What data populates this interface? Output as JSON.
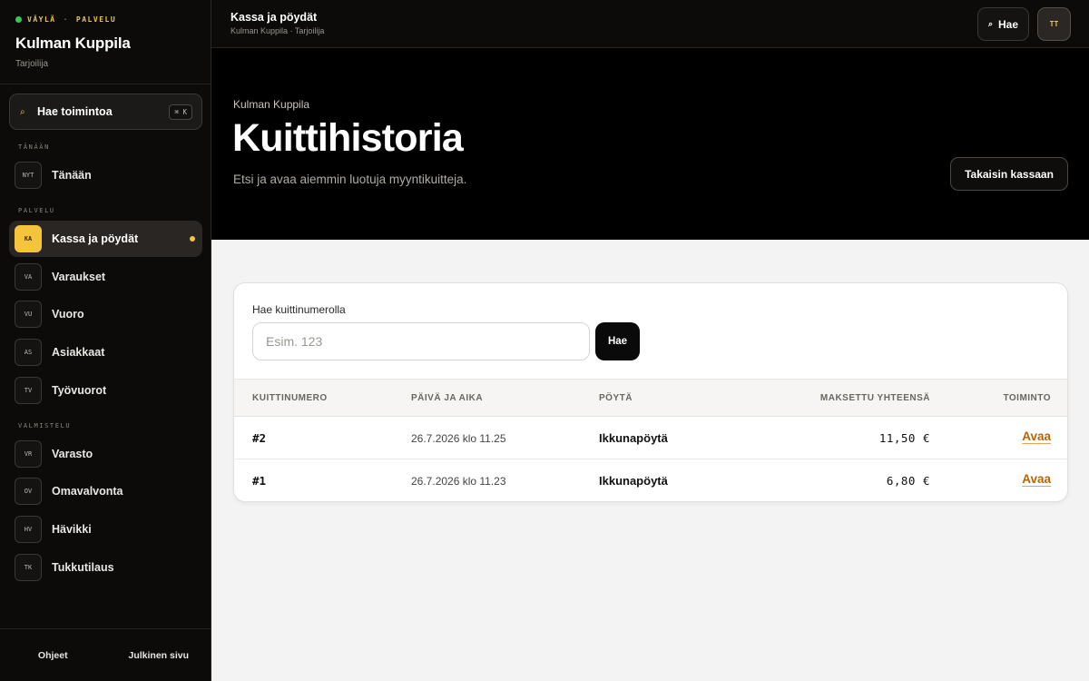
{
  "brand": {
    "tag_left": "VÄYLÄ",
    "tag_sep": "·",
    "tag_right": "PALVELU",
    "name": "Kulman Kuppila",
    "role": "Tarjoilija"
  },
  "command": {
    "icon": "search-icon",
    "label": "Hae toimintoa",
    "shortcut": "⌘ K"
  },
  "sidebar": {
    "sections": [
      {
        "label": "TÄNÄÄN"
      },
      {
        "label": "PALVELU"
      },
      {
        "label": "VALMISTELU"
      }
    ],
    "items": [
      {
        "abbr": "NYT",
        "label": "Tänään"
      },
      {
        "abbr": "KA",
        "label": "Kassa ja pöydät",
        "active": true
      },
      {
        "abbr": "VA",
        "label": "Varaukset"
      },
      {
        "abbr": "VU",
        "label": "Vuoro"
      },
      {
        "abbr": "AS",
        "label": "Asiakkaat"
      },
      {
        "abbr": "TV",
        "label": "Työvuorot"
      },
      {
        "abbr": "VR",
        "label": "Varasto"
      },
      {
        "abbr": "OV",
        "label": "Omavalvonta"
      },
      {
        "abbr": "HV",
        "label": "Hävikki"
      },
      {
        "abbr": "TK",
        "label": "Tukkutilaus"
      }
    ],
    "footer": {
      "help": "Ohjeet",
      "public": "Julkinen sivu"
    }
  },
  "topbar": {
    "title": "Kassa ja pöydät",
    "subtitle": "Kulman Kuppila · Tarjoilija",
    "search_label": "Hae",
    "avatar": "TT"
  },
  "hero": {
    "eyebrow": "Kulman Kuppila",
    "title": "Kuittihistoria",
    "description": "Etsi ja avaa aiemmin luotuja myyntikuitteja.",
    "back_button": "Takaisin kassaan"
  },
  "search": {
    "label": "Hae kuittinumerolla",
    "placeholder": "Esim. 123",
    "button": "Hae"
  },
  "table": {
    "headers": [
      "KUITTINUMERO",
      "PÄIVÄ JA AIKA",
      "PÖYTÄ",
      "MAKSETTU YHTEENSÄ",
      "TOIMINTO"
    ],
    "rows": [
      {
        "number": "#2",
        "datetime": "26.7.2026 klo 11.25",
        "table": "Ikkunapöytä",
        "total": "11,50 €",
        "action": "Avaa"
      },
      {
        "number": "#1",
        "datetime": "26.7.2026 klo 11.23",
        "table": "Ikkunapöytä",
        "total": "6,80 €",
        "action": "Avaa"
      }
    ]
  },
  "colors": {
    "accent": "#f4c43a",
    "link": "#b8650a",
    "status_dot": "#34c759"
  }
}
